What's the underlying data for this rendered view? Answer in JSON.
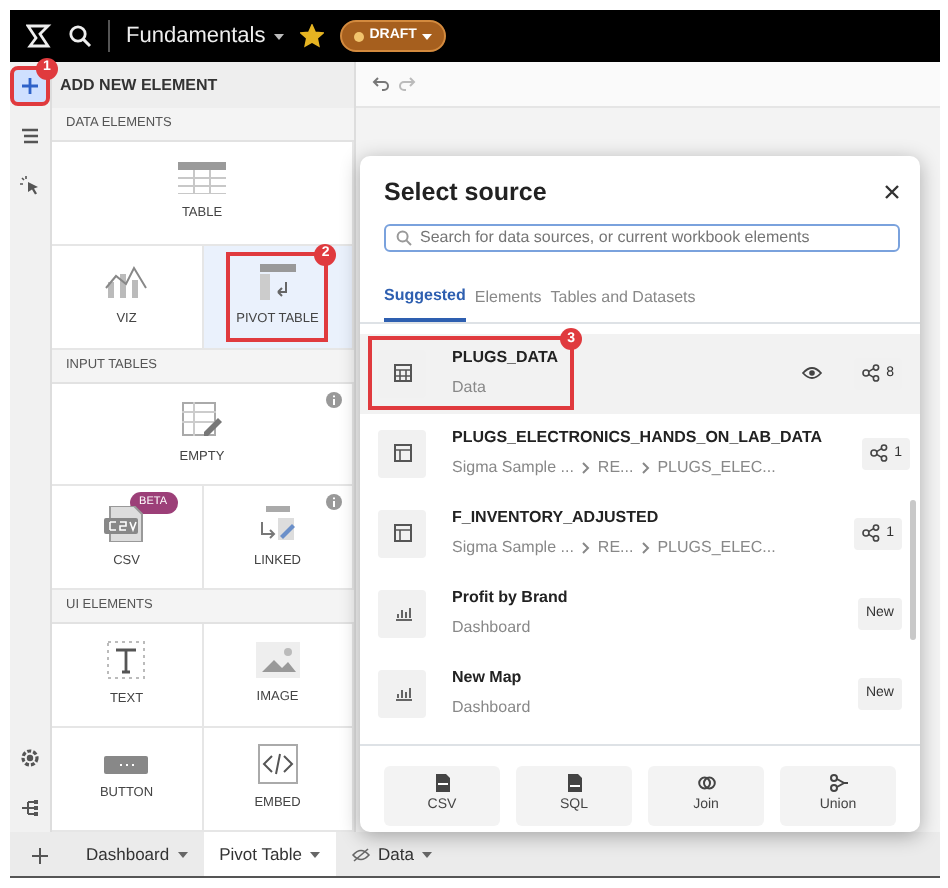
{
  "topbar": {
    "workbook_title": "Fundamentals",
    "starred": true,
    "status": "DRAFT"
  },
  "rail": {
    "top": [
      {
        "kind": "add",
        "selected": true,
        "callout": "1"
      },
      {
        "kind": "layers",
        "selected": false
      },
      {
        "kind": "interactions",
        "selected": false
      }
    ],
    "bottom": [
      {
        "kind": "settings"
      },
      {
        "kind": "lineage"
      }
    ]
  },
  "panel": {
    "title": "ADD NEW ELEMENT",
    "sections": [
      {
        "heading": "DATA ELEMENTS",
        "tiles": [
          {
            "label": "TABLE",
            "kind": "table",
            "selected": false
          }
        ]
      },
      {
        "tiles": [
          {
            "label": "VIZ",
            "kind": "viz",
            "selected": false
          },
          {
            "label": "PIVOT TABLE",
            "kind": "pivot",
            "selected": true,
            "callout": "2"
          }
        ]
      },
      {
        "heading": "INPUT TABLES",
        "tiles": [
          {
            "label": "EMPTY",
            "kind": "empty",
            "info": true,
            "selected": false
          }
        ]
      },
      {
        "tiles": [
          {
            "label": "CSV",
            "kind": "csv",
            "badge": "BETA",
            "selected": false
          },
          {
            "label": "LINKED",
            "kind": "linked",
            "info": true,
            "selected": false
          }
        ]
      },
      {
        "heading": "UI ELEMENTS",
        "tiles": [
          {
            "label": "TEXT",
            "kind": "text",
            "selected": false
          },
          {
            "label": "IMAGE",
            "kind": "image",
            "selected": false
          }
        ]
      },
      {
        "tiles": [
          {
            "label": "BUTTON",
            "kind": "button",
            "selected": false
          },
          {
            "label": "EMBED",
            "kind": "embed",
            "selected": false
          }
        ]
      }
    ]
  },
  "page_tabs": [
    {
      "label": "Dashboard",
      "selected": false,
      "hidden": false
    },
    {
      "label": "Pivot Table",
      "selected": true,
      "hidden": false
    },
    {
      "label": "Data",
      "selected": false,
      "hidden": true
    }
  ],
  "dialog": {
    "title": "Select source",
    "search": {
      "placeholder": "Search for data sources, or current workbook elements"
    },
    "tabs": [
      {
        "label": "Suggested",
        "selected": true
      },
      {
        "label": "Elements",
        "selected": false
      },
      {
        "label": "Tables and Datasets",
        "selected": false
      }
    ],
    "sources": [
      {
        "name": "PLUGS_DATA",
        "kind": "table",
        "subtitle": "Data",
        "preview": true,
        "usage": "8",
        "selected": true,
        "callout": "3"
      },
      {
        "name": "PLUGS_ELECTRONICS_HANDS_ON_LAB_DATA",
        "kind": "dataset",
        "path": [
          "Sigma Sample ...",
          "RE...",
          "PLUGS_ELEC..."
        ],
        "preview": false,
        "usage": "1",
        "selected": false
      },
      {
        "name": "F_INVENTORY_ADJUSTED",
        "kind": "dataset",
        "path": [
          "Sigma Sample ...",
          "RE...",
          "PLUGS_ELEC..."
        ],
        "preview": false,
        "usage": "1",
        "selected": false
      },
      {
        "name": "Profit by Brand",
        "kind": "dashboard",
        "subtitle": "Dashboard",
        "preview": false,
        "badge": "New",
        "selected": false
      },
      {
        "name": "New Map",
        "kind": "dashboard",
        "subtitle": "Dashboard",
        "preview": false,
        "badge": "New",
        "selected": false
      }
    ],
    "actions": [
      {
        "label": "CSV",
        "kind": "csv"
      },
      {
        "label": "SQL",
        "kind": "sql"
      },
      {
        "label": "Join",
        "kind": "join"
      },
      {
        "label": "Union",
        "kind": "union"
      }
    ]
  }
}
